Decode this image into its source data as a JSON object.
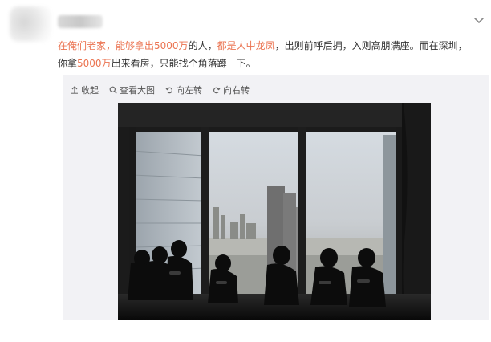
{
  "post": {
    "line1": [
      {
        "text": "在俺们老家，",
        "highlight": true
      },
      {
        "text": "能够拿出5000万",
        "highlight": true
      },
      {
        "text": "的人，",
        "highlight": false
      },
      {
        "text": "都是人中龙凤",
        "highlight": true
      },
      {
        "text": "，出则前呼后拥，入则高朋满座。而在深圳，",
        "highlight": false
      }
    ],
    "line2": [
      {
        "text": "你拿",
        "highlight": false
      },
      {
        "text": "5000万",
        "highlight": true
      },
      {
        "text": "出来看房，只能找个角落蹲一下。",
        "highlight": false
      }
    ]
  },
  "toolbar": {
    "collapse": "收起",
    "view_large": "查看大图",
    "rotate_left": "向左转",
    "rotate_right": "向右转"
  },
  "colors": {
    "highlight": "#eb7350",
    "text": "#333333",
    "media_bg": "#f2f2f5"
  },
  "icons": {
    "collapse": "up-arrow-icon",
    "view_large": "magnifier-icon",
    "rotate_left": "rotate-left-icon",
    "rotate_right": "rotate-right-icon",
    "menu": "chevron-down-icon"
  }
}
